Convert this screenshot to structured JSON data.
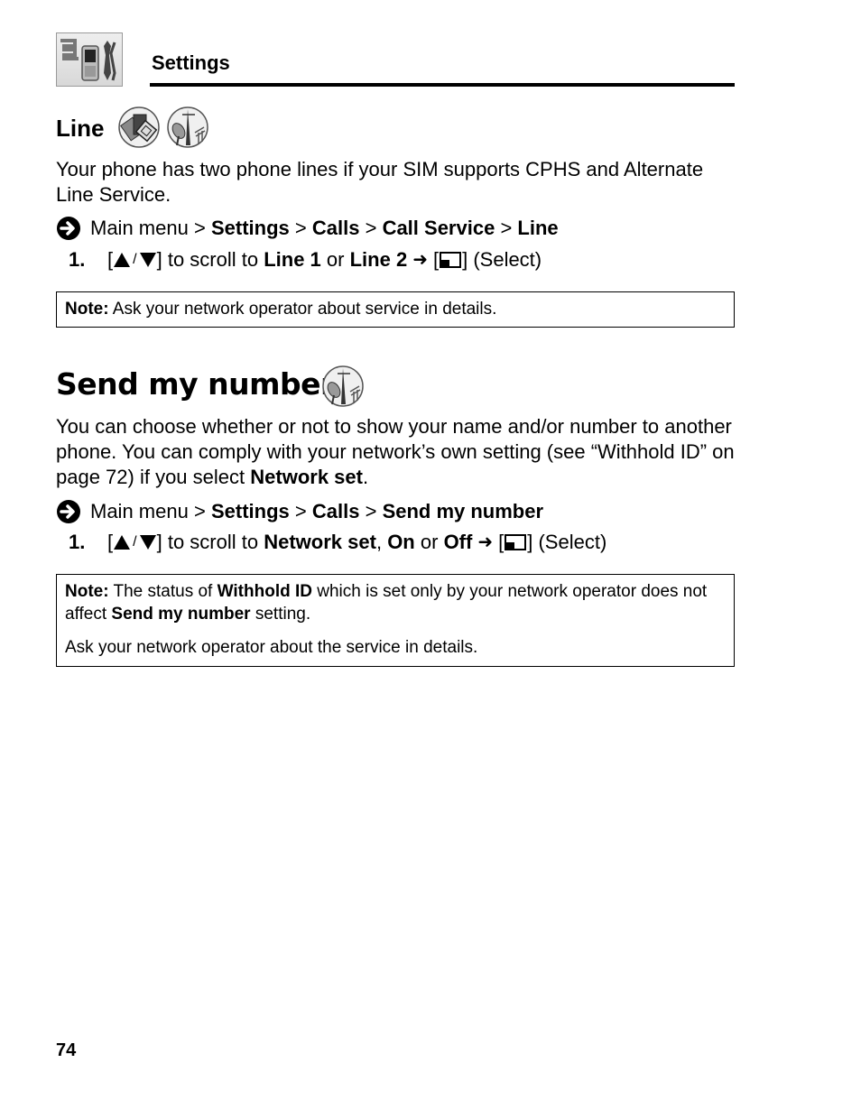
{
  "header": {
    "icon": "settings-phone-wrench-icon",
    "title": "Settings"
  },
  "line_section": {
    "heading": "Line",
    "icons": [
      "sim-cards-icon",
      "network-antenna-icon"
    ],
    "description": "Your phone has two phone lines if your SIM supports CPHS and Alternate Line Service.",
    "path": {
      "icon": "arrow-right-icon",
      "prefix": "Main menu",
      "sep": ">",
      "items": [
        "Settings",
        "Calls",
        "Call Service",
        "Line"
      ]
    },
    "step": {
      "number": "1.",
      "scroll_text": "to scroll to",
      "option1": "Line 1",
      "or": "or",
      "option2": "Line 2",
      "select_label": "(Select)"
    },
    "note": {
      "label": "Note:",
      "text": "Ask your network operator about service in details."
    }
  },
  "send_section": {
    "heading": "Send my number",
    "icon": "network-antenna-icon",
    "description": {
      "part1": "You can choose whether or not to show your name and/or number to another phone. You can comply with your network’s own setting (see “Withhold ID” on page 72) if you select",
      "bold": "Network set",
      "end": "."
    },
    "path": {
      "icon": "arrow-right-icon",
      "prefix": "Main menu",
      "sep": ">",
      "items": [
        "Settings",
        "Calls",
        "Send my number"
      ]
    },
    "step": {
      "number": "1.",
      "scroll_text": "to scroll to",
      "option1": "Network set",
      "comma": ",",
      "option2": "On",
      "or": "or",
      "option3": "Off",
      "select_label": "(Select)"
    },
    "note": {
      "label": "Note:",
      "t1": "The status of",
      "b1": "Withhold ID",
      "t2": "which is set only by your network operator does not affect",
      "b2": "Send my number",
      "t3": "setting.",
      "p2": "Ask your network operator about the service in details."
    }
  },
  "footer": {
    "page_number": "74"
  }
}
